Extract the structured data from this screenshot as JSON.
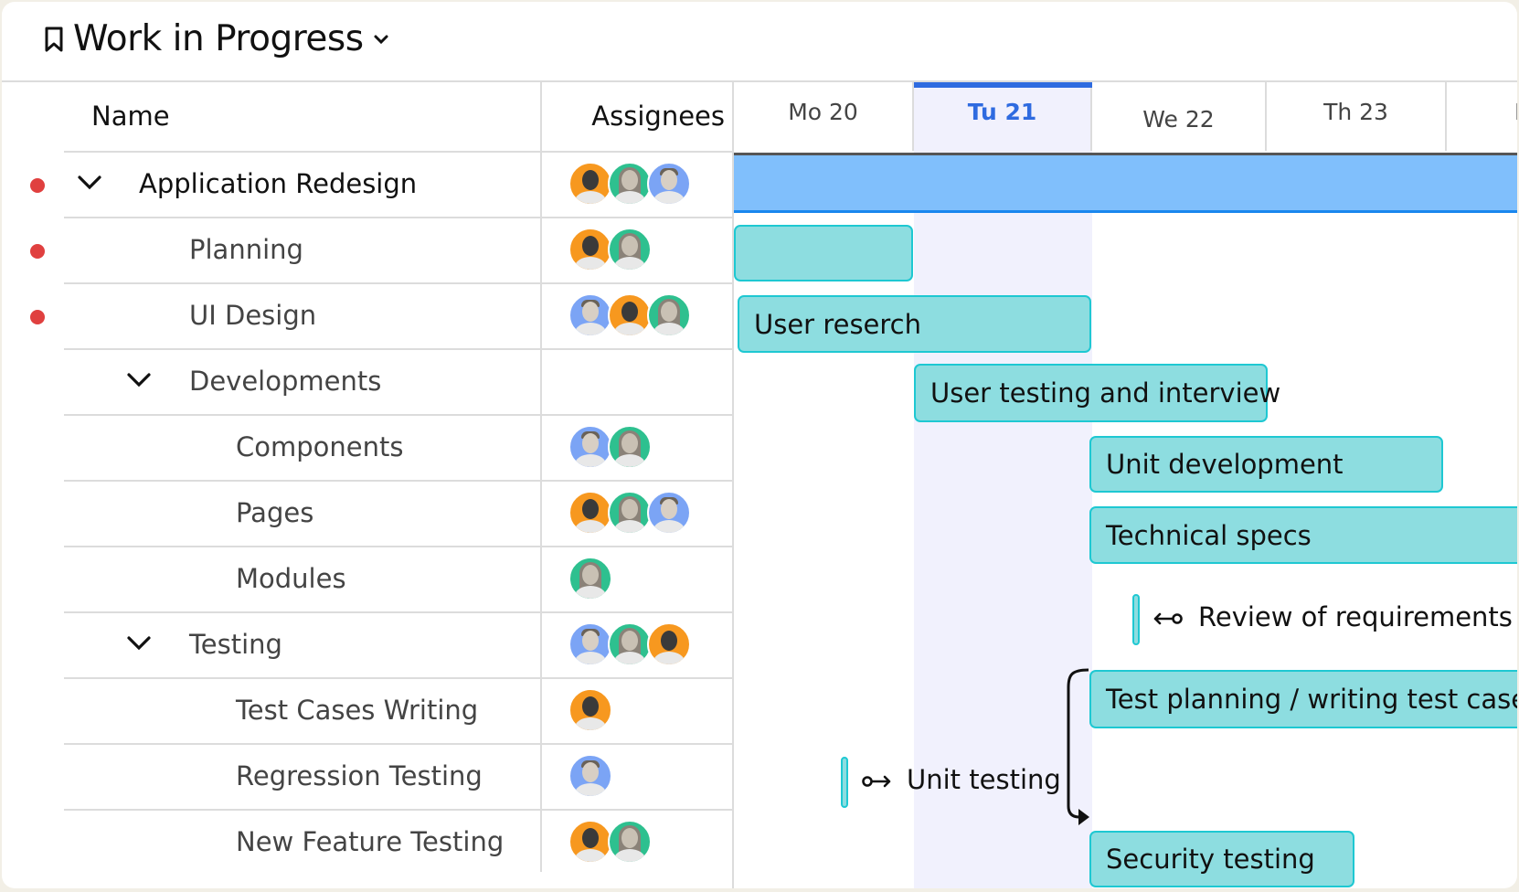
{
  "header": {
    "title": "Work in Progress",
    "bookmark_icon": "bookmark-icon",
    "dropdown_icon": "chevron-down-icon"
  },
  "columns": {
    "name": "Name",
    "assignees": "Assignees"
  },
  "timeline": {
    "days": [
      {
        "label": "Mo 20",
        "today": false
      },
      {
        "label": "Tu 21",
        "today": true
      },
      {
        "label": "We 22",
        "today": false
      },
      {
        "label": "Th 23",
        "today": false
      },
      {
        "label": "F",
        "today": false
      }
    ],
    "today_color": "#2f6be0"
  },
  "tasks": [
    {
      "name": "Application Redesign",
      "level": 0,
      "expandable": true,
      "flag": true,
      "assignees": [
        "orange-male",
        "green-female",
        "blue-male"
      ]
    },
    {
      "name": "Planning",
      "level": 1,
      "expandable": false,
      "flag": true,
      "assignees": [
        "orange-male",
        "green-female"
      ]
    },
    {
      "name": "UI Design",
      "level": 1,
      "expandable": false,
      "flag": true,
      "assignees": [
        "blue-male",
        "orange-male",
        "green-female"
      ]
    },
    {
      "name": "Developments",
      "level": 1,
      "expandable": true,
      "flag": false,
      "assignees": []
    },
    {
      "name": "Components",
      "level": 2,
      "expandable": false,
      "flag": false,
      "assignees": [
        "blue-male",
        "green-female"
      ]
    },
    {
      "name": "Pages",
      "level": 2,
      "expandable": false,
      "flag": false,
      "assignees": [
        "orange-male",
        "green-female",
        "blue-male"
      ]
    },
    {
      "name": "Modules",
      "level": 2,
      "expandable": false,
      "flag": false,
      "assignees": [
        "green-female"
      ]
    },
    {
      "name": "Testing",
      "level": 1,
      "expandable": true,
      "flag": false,
      "assignees": [
        "blue-male",
        "green-female",
        "orange-male"
      ]
    },
    {
      "name": "Test Cases Writing",
      "level": 2,
      "expandable": false,
      "flag": false,
      "assignees": [
        "orange-male"
      ]
    },
    {
      "name": "Regression Testing",
      "level": 2,
      "expandable": false,
      "flag": false,
      "assignees": [
        "blue-male"
      ]
    },
    {
      "name": "New Feature Testing",
      "level": 2,
      "expandable": false,
      "flag": false,
      "assignees": [
        "orange-male",
        "green-female"
      ]
    }
  ],
  "bars": [
    {
      "label": "",
      "type": "summary"
    },
    {
      "label": "",
      "type": "task"
    },
    {
      "label": "User reserch",
      "type": "task"
    },
    {
      "label": "User testing and interview",
      "type": "task"
    },
    {
      "label": "Unit development",
      "type": "task"
    },
    {
      "label": "Technical specs",
      "type": "task"
    },
    {
      "label": "Review of  requirements",
      "type": "milestone",
      "link_icon": "link-left-icon"
    },
    {
      "label": "Test planning / writing test cases",
      "type": "task"
    },
    {
      "label": "Unit testing",
      "type": "milestone",
      "link_icon": "link-right-icon"
    },
    {
      "label": "Security testing",
      "type": "task"
    }
  ],
  "colors": {
    "flag": "#e0403f",
    "bar_fill": "#8ddde0",
    "bar_border": "#1ec8d2",
    "summary_fill": "#80bffc",
    "today_band": "#f1f1fd",
    "avatar_orange": "#f7981f",
    "avatar_green": "#2ec08f",
    "avatar_blue": "#7ba4f5"
  }
}
